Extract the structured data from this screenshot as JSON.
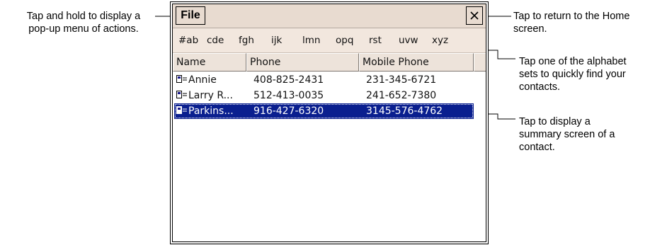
{
  "callouts": {
    "file_menu": [
      "Tap and hold to display a",
      "pop-up menu of actions."
    ],
    "close": [
      "Tap to return to the Home",
      "screen."
    ],
    "alphabet": [
      "Tap one of the alphabet",
      "sets to quickly find your",
      "contacts."
    ],
    "summary": [
      "Tap to display a",
      "summary screen of a",
      "contact."
    ]
  },
  "title_bar": {
    "menu_label": "File",
    "close_icon": "close-icon"
  },
  "alphabet_sets": [
    "#ab",
    "cde",
    "fgh",
    "ijk",
    "lmn",
    "opq",
    "rst",
    "uvw",
    "xyz"
  ],
  "list": {
    "columns": [
      "Name",
      "Phone",
      "Mobile Phone"
    ],
    "rows": [
      {
        "name": "Annie",
        "phone": "408-825-2431",
        "mobile": "231-345-6721",
        "selected": false
      },
      {
        "name": "Larry R...",
        "phone": "512-413-0035",
        "mobile": "241-652-7380",
        "selected": false
      },
      {
        "name": "Parkins...",
        "phone": "916-427-6320",
        "mobile": "3145-576-4762",
        "selected": true
      }
    ]
  },
  "colors": {
    "title_bar": "#e8dbd0",
    "alphabet_bar": "#f2e7de",
    "selection": "#0a1f8f"
  }
}
